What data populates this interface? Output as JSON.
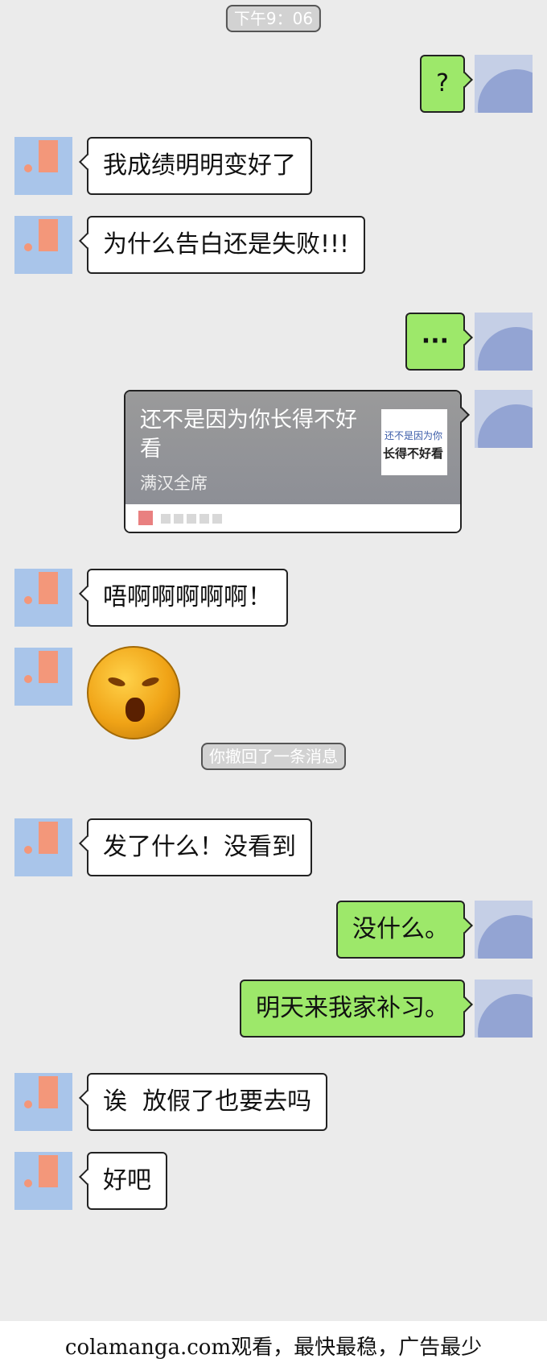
{
  "time_label": "下午9：06",
  "recall_notice": "你撤回了一条消息",
  "messages": [
    {
      "side": "out",
      "text": "?"
    },
    {
      "side": "in",
      "text": "我成绩明明变好了"
    },
    {
      "side": "in",
      "text": "为什么告白还是失败!!!"
    },
    {
      "side": "out",
      "text": "···"
    },
    {
      "side": "in",
      "text": "唔啊啊啊啊啊！"
    },
    {
      "side": "in",
      "text": "发了什么！没看到"
    },
    {
      "side": "out",
      "text": "没什么。"
    },
    {
      "side": "out",
      "text": "明天来我家补习。"
    },
    {
      "side": "in",
      "text": "诶  放假了也要去吗"
    },
    {
      "side": "in",
      "text": "好吧"
    }
  ],
  "link_card": {
    "title": "还不是因为你长得不好看",
    "source": "满汉全席",
    "thumb_line1": "还不是因为你",
    "thumb_line2": "长得不好看"
  },
  "emoji_icon": "screaming-face-sticker",
  "footer": "colamanga.com观看，最快最稳，广告最少",
  "colors": {
    "outgoing": "#9de86a",
    "incoming": "#ffffff",
    "background": "#ebebeb"
  }
}
